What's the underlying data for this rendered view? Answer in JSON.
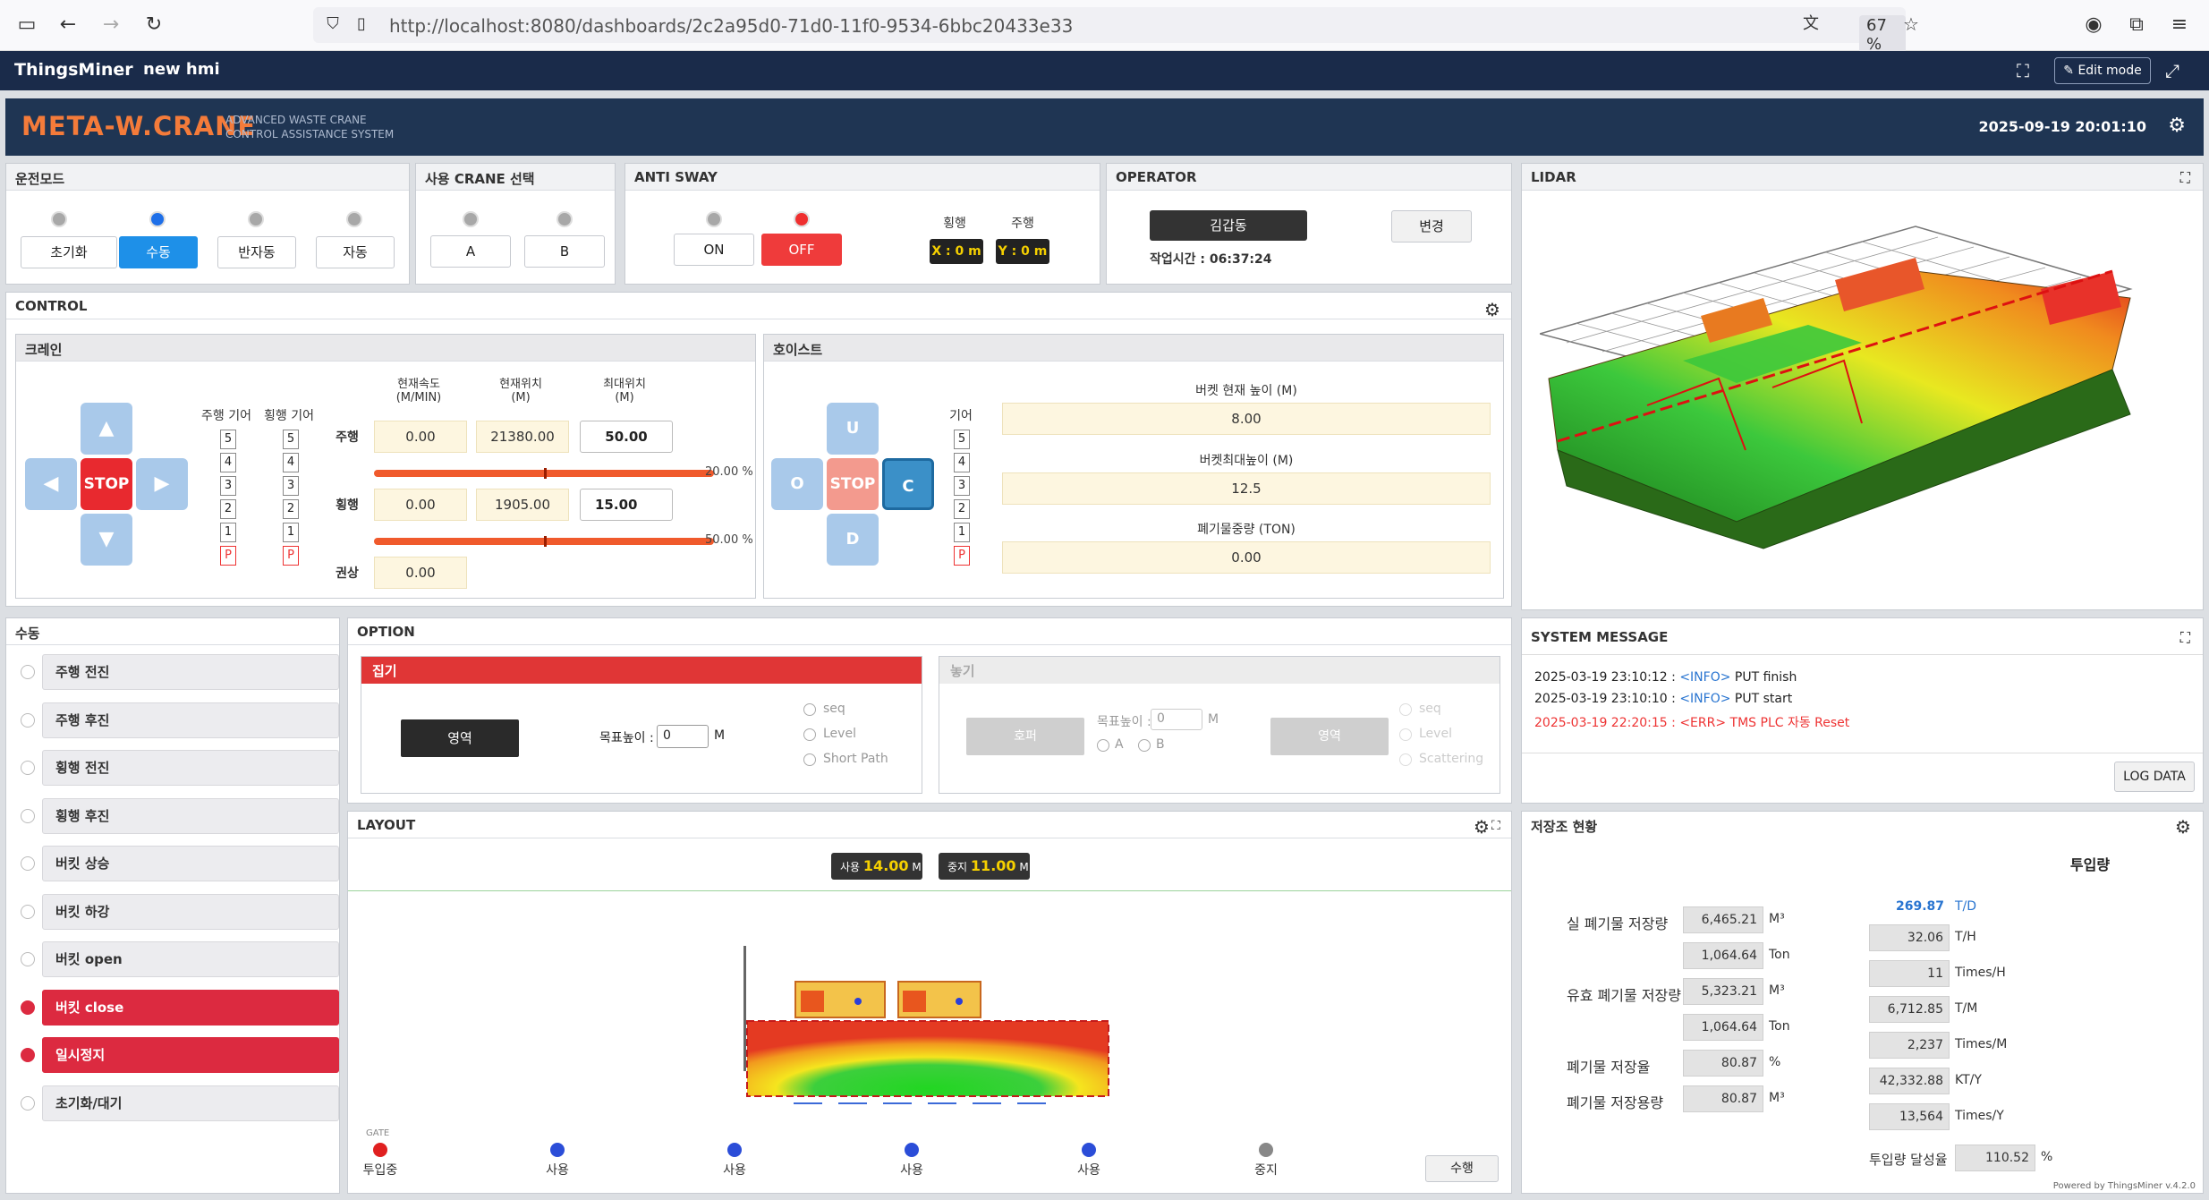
{
  "browser": {
    "url": "http://localhost:8080/dashboards/2c2a95d0-71d0-11f0-9534-6bbc20433e33",
    "zoom": "67 %"
  },
  "appbar": {
    "logo": "ThingsMiner",
    "hmi_name": "new hmi",
    "edit_mode": "✎ Edit mode"
  },
  "header": {
    "brand": "META-W.CRANE",
    "subtitle_line1": "ADVANCED WASTE CRANE",
    "subtitle_line2": "CONTROL ASSISTANCE SYSTEM",
    "datetime": "2025-09-19 20:01:10"
  },
  "mode": {
    "title": "운전모드",
    "buttons": [
      "초기화",
      "수동",
      "반자동",
      "자동"
    ],
    "active": "수동"
  },
  "crane_select": {
    "title": "사용 CRANE 선택",
    "buttons": [
      "A",
      "B"
    ]
  },
  "anti_sway": {
    "title": "ANTI SWAY",
    "on": "ON",
    "off": "OFF",
    "col1": "횡행",
    "col2": "주행",
    "x_val": "X : 0 m",
    "y_val": "Y : 0 m"
  },
  "operator": {
    "title": "OPERATOR",
    "name": "김갑동",
    "change": "변경",
    "worktime": "작업시간 : 06:37:24"
  },
  "lidar": {
    "title": "LIDAR"
  },
  "control": {
    "title": "CONTROL",
    "crane": {
      "title": "크레인",
      "stop": "STOP",
      "gear1_label": "주행 기어",
      "gear2_label": "횡행 기어",
      "gears": [
        "5",
        "4",
        "3",
        "2",
        "1",
        "P"
      ],
      "col_speed": "현재속도",
      "col_speed_unit": "(M/MIN)",
      "col_pos": "현재위치",
      "col_pos_unit": "(M)",
      "col_max": "최대위치",
      "col_max_unit": "(M)",
      "row1": "주행",
      "row2": "횡행",
      "row3": "권상",
      "drive_speed": "0.00",
      "drive_pos": "21380.00",
      "drive_max": "50.00",
      "drive_pct": "20.00 %",
      "trav_speed": "0.00",
      "trav_pos": "1905.00",
      "trav_max": "15.00",
      "trav_pct": "50.00 %",
      "hoist_speed": "0.00"
    },
    "hoist": {
      "title": "호이스트",
      "u": "U",
      "o": "O",
      "stop": "STOP",
      "c": "C",
      "d": "D",
      "gear_label": "기어",
      "bucket_height_label": "버켓 현재 높이 (M)",
      "bucket_height": "8.00",
      "bucket_max_label": "버켓최대높이 (M)",
      "bucket_max": "12.5",
      "waste_weight_label": "폐기물중량 (TON)",
      "waste_weight": "0.00"
    }
  },
  "manual": {
    "title": "수동",
    "items": [
      {
        "label": "주행 전진",
        "on": false
      },
      {
        "label": "주행 후진",
        "on": false
      },
      {
        "label": "횡행 전진",
        "on": false
      },
      {
        "label": "횡행 후진",
        "on": false
      },
      {
        "label": "버킷 상승",
        "on": false
      },
      {
        "label": "버킷 하강",
        "on": false
      },
      {
        "label": "버킷 open",
        "on": false
      },
      {
        "label": "버킷 close",
        "on": true
      },
      {
        "label": "일시정지",
        "on": true
      },
      {
        "label": "초기화/대기",
        "on": false
      }
    ]
  },
  "option": {
    "title": "OPTION",
    "grab_title": "집기",
    "grab_area_btn": "영역",
    "target_label": "목표높이 :",
    "target_val": "0",
    "unit_m": "M",
    "opt_seq": "seq",
    "opt_level": "Level",
    "opt_short": "Short Path",
    "place_title": "놓기",
    "place_hopper": "호퍼",
    "place_area": "영역",
    "place_a": "A",
    "place_b": "B",
    "opt_scatter": "Scattering"
  },
  "layout": {
    "title": "LAYOUT",
    "use_label": "사용",
    "use_val": "14.00",
    "stop_label": "중지",
    "stop_val": "11.00",
    "unit": "M",
    "gate_label": "GATE",
    "gates": [
      "투입중",
      "사용",
      "사용",
      "사용",
      "사용",
      "중지"
    ],
    "manual_btn": "수행"
  },
  "system_message": {
    "title": "SYSTEM MESSAGE",
    "messages": [
      {
        "time": "2025-03-19 23:10:12 :",
        "tag": "<INFO>",
        "text": "PUT finish"
      },
      {
        "time": "2025-03-19 23:10:10 :",
        "tag": "<INFO>",
        "text": "PUT start"
      },
      {
        "time": "2025-03-19 22:20:15 :",
        "tag": "<ERR>",
        "text": "TMS PLC 자동 Reset"
      }
    ],
    "log_btn": "LOG DATA"
  },
  "storage": {
    "title": "저장조 현황",
    "input_title": "투입량",
    "real_label": "실 폐기물 저장량",
    "real_m3": "6,465.21",
    "real_ton": "1,064.64",
    "eff_label": "유효 폐기물 저장량",
    "eff_m3": "5,323.21",
    "eff_ton": "1,064.64",
    "rate_label": "폐기물 저장율",
    "rate": "80.87",
    "cap_label": "폐기물 저장용량",
    "cap": "80.87",
    "td": "269.87",
    "td_unit": "T/D",
    "th": "32.06",
    "th_unit": "T/H",
    "times_h": "11",
    "times_h_unit": "Times/H",
    "tm": "6,712.85",
    "tm_unit": "T/M",
    "times_m": "2,237",
    "times_m_unit": "Times/M",
    "kty": "42,332.88",
    "kty_unit": "KT/Y",
    "times_y": "13,564",
    "times_y_unit": "Times/Y",
    "achieve_label": "투입량 달성율",
    "achieve": "110.52",
    "unit_m3": "M³",
    "unit_ton": "Ton",
    "unit_pct": "%"
  },
  "footer": "Powered by ThingsMiner v.4.2.0"
}
